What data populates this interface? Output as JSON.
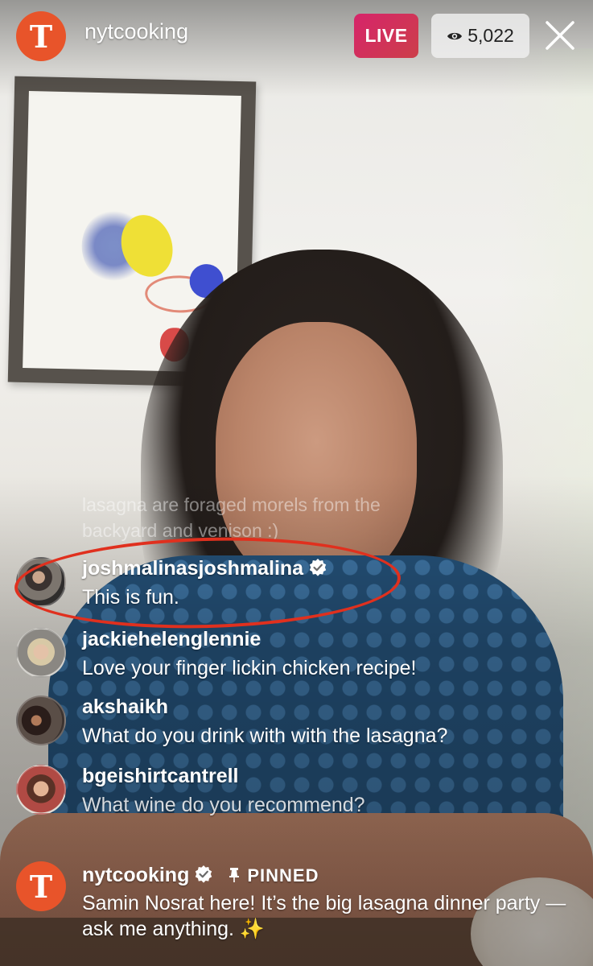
{
  "header": {
    "logo_letter": "T",
    "channel_name": "nytcooking",
    "live_label": "LIVE",
    "viewer_count": "5,022"
  },
  "comments": {
    "faded_lines": [
      "lasagna are foraged morels from the",
      "backyard and venison :)"
    ],
    "items": [
      {
        "user": "joshmalinasjoshmalina",
        "verified": true,
        "message": "This is fun."
      },
      {
        "user": "jackiehelenglennie",
        "verified": false,
        "message": "Love your finger lickin chicken  recipe!"
      },
      {
        "user": "akshaikh",
        "verified": false,
        "message": "What do you drink with with the lasagna?"
      },
      {
        "user": "bgeishirtcantrell",
        "verified": false,
        "message": "What wine do you recommend?"
      }
    ]
  },
  "pinned": {
    "logo_letter": "T",
    "user": "nytcooking",
    "verified": true,
    "pin_label": "PINNED",
    "message": "Samin Nosrat here! It’s the big lasagna dinner party — ask me anything. ✨"
  },
  "colors": {
    "live_gradient_start": "#d6246a",
    "live_gradient_end": "#cc3f4a",
    "nyt_orange": "#e8542a",
    "highlight_ring": "#e0301e",
    "verified_blue": "#ffffff"
  }
}
